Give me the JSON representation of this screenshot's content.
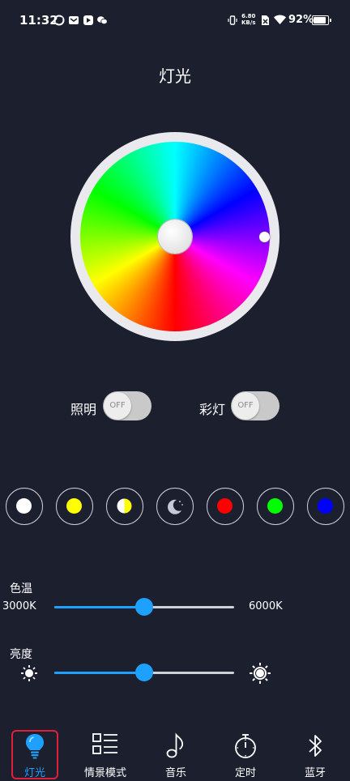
{
  "status_bar": {
    "time": "11:32",
    "speed_value": "6.80",
    "speed_unit": "KB/s",
    "battery": "92%",
    "battery_level": 0.92
  },
  "title": "灯光",
  "toggles": [
    {
      "label": "照明",
      "state": "OFF"
    },
    {
      "label": "彩灯",
      "state": "OFF"
    }
  ],
  "presets": [
    {
      "name": "white",
      "color": "#ffffff"
    },
    {
      "name": "yellow",
      "color": "#ffff00"
    },
    {
      "name": "warm-half",
      "color": "#ffff00"
    },
    {
      "name": "night",
      "color": "#c8c8d8"
    },
    {
      "name": "red",
      "color": "#ff0000"
    },
    {
      "name": "green",
      "color": "#00ff00"
    },
    {
      "name": "blue",
      "color": "#0000ff"
    }
  ],
  "color_temp": {
    "label": "色温",
    "min_label": "3000K",
    "max_label": "6000K",
    "level": 0.5
  },
  "brightness": {
    "label": "亮度",
    "level": 0.5
  },
  "nav": {
    "items": [
      {
        "label": "灯光",
        "icon": "bulb-icon",
        "active": true
      },
      {
        "label": "情景模式",
        "icon": "list-icon"
      },
      {
        "label": "音乐",
        "icon": "music-note-icon"
      },
      {
        "label": "定时",
        "icon": "stopwatch-icon"
      },
      {
        "label": "蓝牙",
        "icon": "bluetooth-icon"
      }
    ]
  },
  "colors": {
    "background": "#1c1f2e",
    "accent": "#1ea0ff",
    "highlight_border": "#e0203a"
  }
}
